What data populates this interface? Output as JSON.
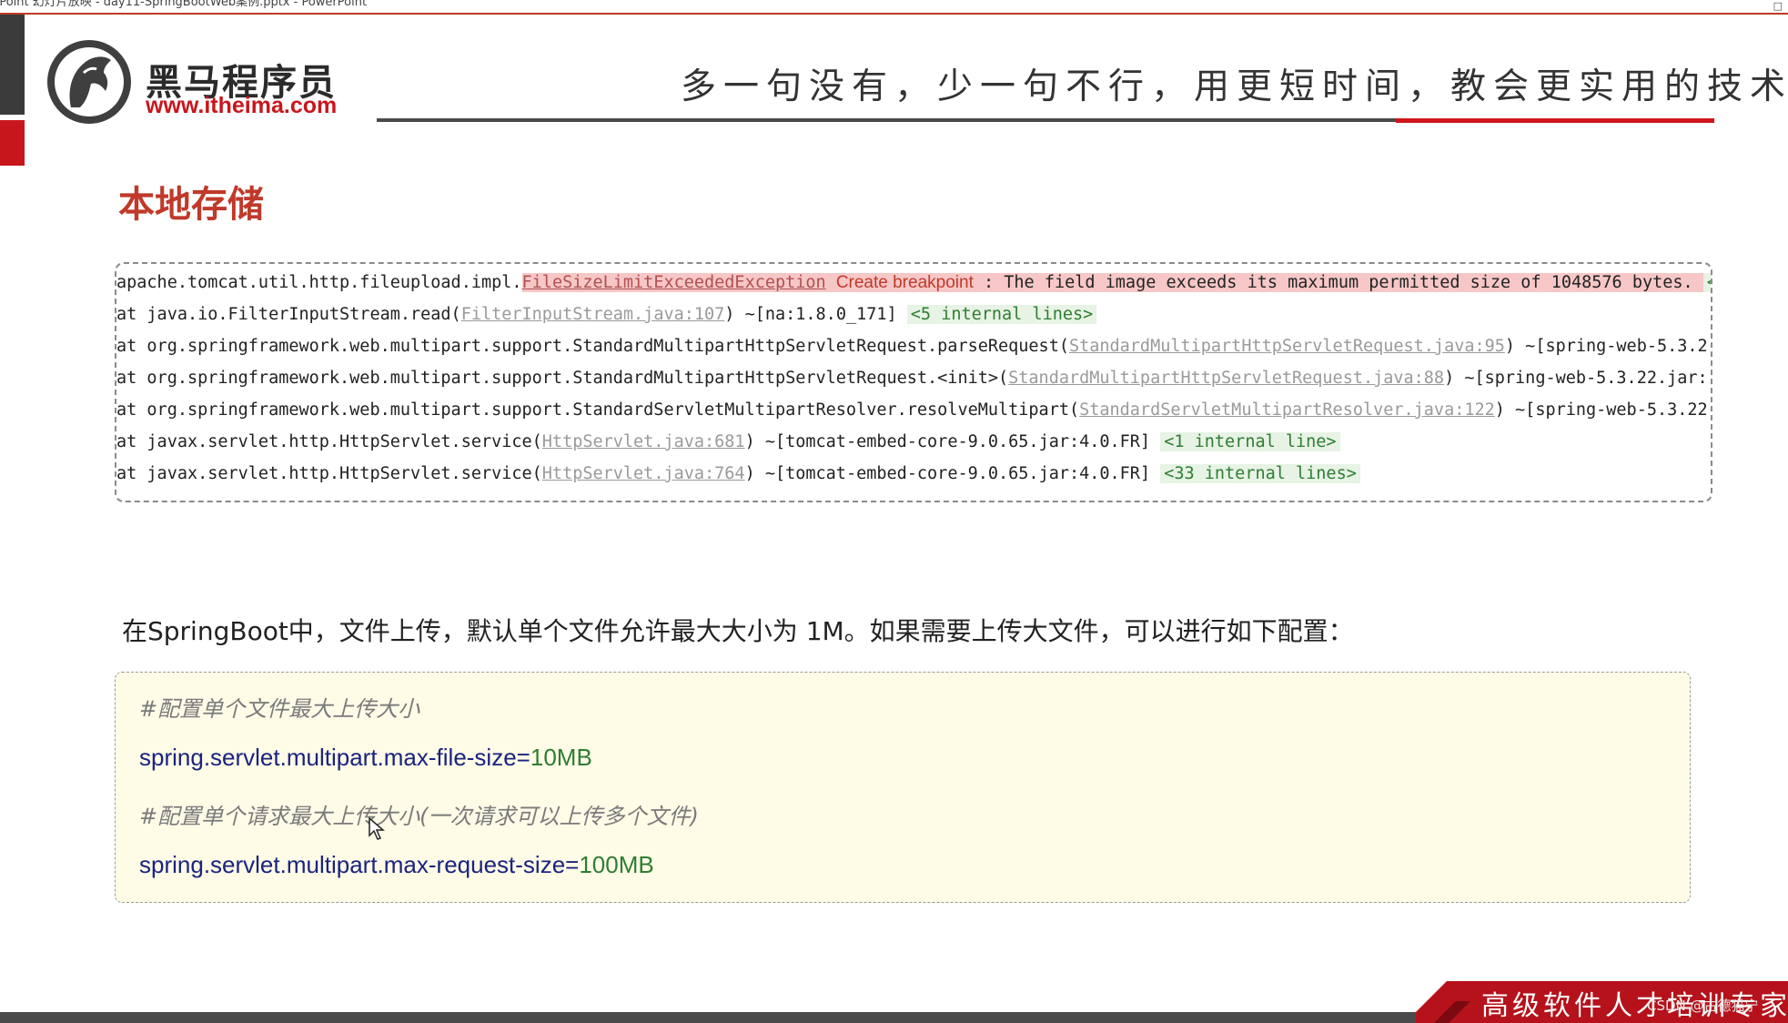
{
  "window": {
    "title": "rPoint 幻灯片放映 - day11-SpringBootWeb案例.pptx - PowerPoint"
  },
  "header": {
    "logo_cn": "黑马程序员",
    "logo_url": "www.itheima.com",
    "slogan": "多一句没有，少一句不行，用更短时间，教会更实用的技术！",
    "accent_color": "#c8161d"
  },
  "slide": {
    "title": "本地存储",
    "console": {
      "line1": {
        "prefix": "apache.tomcat.util.http.fileupload.impl.",
        "exception": "FileSizeLimitExceededException",
        "breakpoint": "Create breakpoint",
        "message": " : The field image exceeds its maximum permitted size of 1048576 bytes.",
        "tail": "<"
      },
      "line2": {
        "prefix": "at java.io.FilterInputStream.read(",
        "link": "FilterInputStream.java:107",
        "suffix": ") ~[na:1.8.0_171] ",
        "badge": "<5 internal lines>"
      },
      "line3": {
        "prefix": "at org.springframework.web.multipart.support.StandardMultipartHttpServletRequest.parseRequest(",
        "link": "StandardMultipartHttpServletRequest.java:95",
        "suffix": ") ~[spring-web-5.3.2"
      },
      "line4": {
        "prefix": "at org.springframework.web.multipart.support.StandardMultipartHttpServletRequest.<init>(",
        "link": "StandardMultipartHttpServletRequest.java:88",
        "suffix": ") ~[spring-web-5.3.22.jar:"
      },
      "line5": {
        "prefix": "at org.springframework.web.multipart.support.StandardServletMultipartResolver.resolveMultipart(",
        "link": "StandardServletMultipartResolver.java:122",
        "suffix": ") ~[spring-web-5.3.22"
      },
      "line6": {
        "prefix": "at javax.servlet.http.HttpServlet.service(",
        "link": "HttpServlet.java:681",
        "suffix": ") ~[tomcat-embed-core-9.0.65.jar:4.0.FR] ",
        "badge": "<1 internal line>"
      },
      "line7": {
        "prefix": "at javax.servlet.http.HttpServlet.service(",
        "link": "HttpServlet.java:764",
        "suffix": ") ~[tomcat-embed-core-9.0.65.jar:4.0.FR] ",
        "badge": "<33 internal lines>"
      }
    },
    "description": "在SpringBoot中，文件上传，默认单个文件允许最大大小为 1M。如果需要上传大文件，可以进行如下配置：",
    "config": {
      "comment1": "#配置单个文件最大上传大小",
      "key1": "spring.servlet.multipart.max-file-size",
      "val1": "10MB",
      "comment2": "#配置单个请求最大上传大小(一次请求可以上传多个文件)",
      "key2": "spring.servlet.multipart.max-request-size",
      "val2": "100MB",
      "eq": "="
    }
  },
  "footer": {
    "text": "高级软件人才培训专家",
    "watermark": "CSDN @古德猫宁"
  }
}
